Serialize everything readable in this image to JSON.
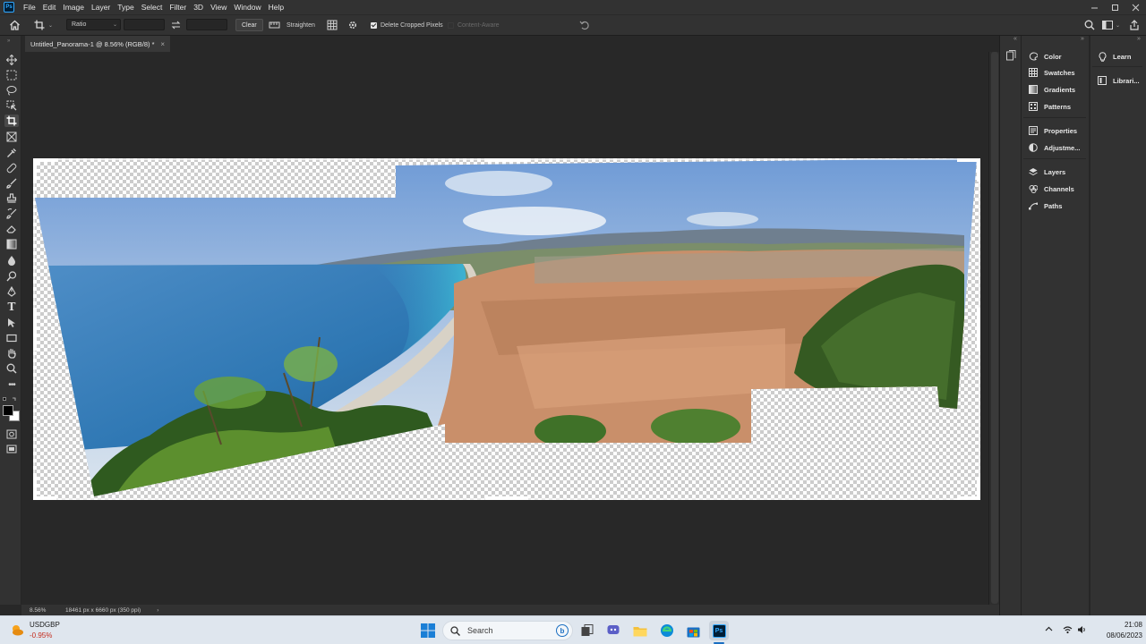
{
  "app": {
    "logo_text": "Ps"
  },
  "menu": [
    "File",
    "Edit",
    "Image",
    "Layer",
    "Type",
    "Select",
    "Filter",
    "3D",
    "View",
    "Window",
    "Help"
  ],
  "options": {
    "ratio_select": "Ratio",
    "clear_label": "Clear",
    "straighten_label": "Straighten",
    "delete_cropped_label": "Delete Cropped Pixels",
    "delete_cropped_checked": true,
    "content_aware_label": "Content-Aware",
    "content_aware_checked": false
  },
  "document": {
    "tab_title": "Untitled_Panorama-1 @ 8.56% (RGB/8) *"
  },
  "panels": {
    "group1": [
      "Color",
      "Swatches",
      "Gradients",
      "Patterns"
    ],
    "group2": [
      "Properties",
      "Adjustme..."
    ],
    "group3": [
      "Layers",
      "Channels",
      "Paths"
    ],
    "side": [
      "Learn",
      "Librari..."
    ]
  },
  "status": {
    "zoom": "8.56%",
    "doc_info": "18461 px x 6660 px (350 ppi)"
  },
  "taskbar": {
    "ticker": "USDGBP",
    "change": "-0.95%",
    "search_placeholder": "Search",
    "time": "21:08",
    "date": "08/06/2023"
  },
  "colors": {
    "accent": "#31a8ff",
    "negative": "#c42b1c",
    "foreground": "#000000",
    "background": "#ffffff"
  }
}
